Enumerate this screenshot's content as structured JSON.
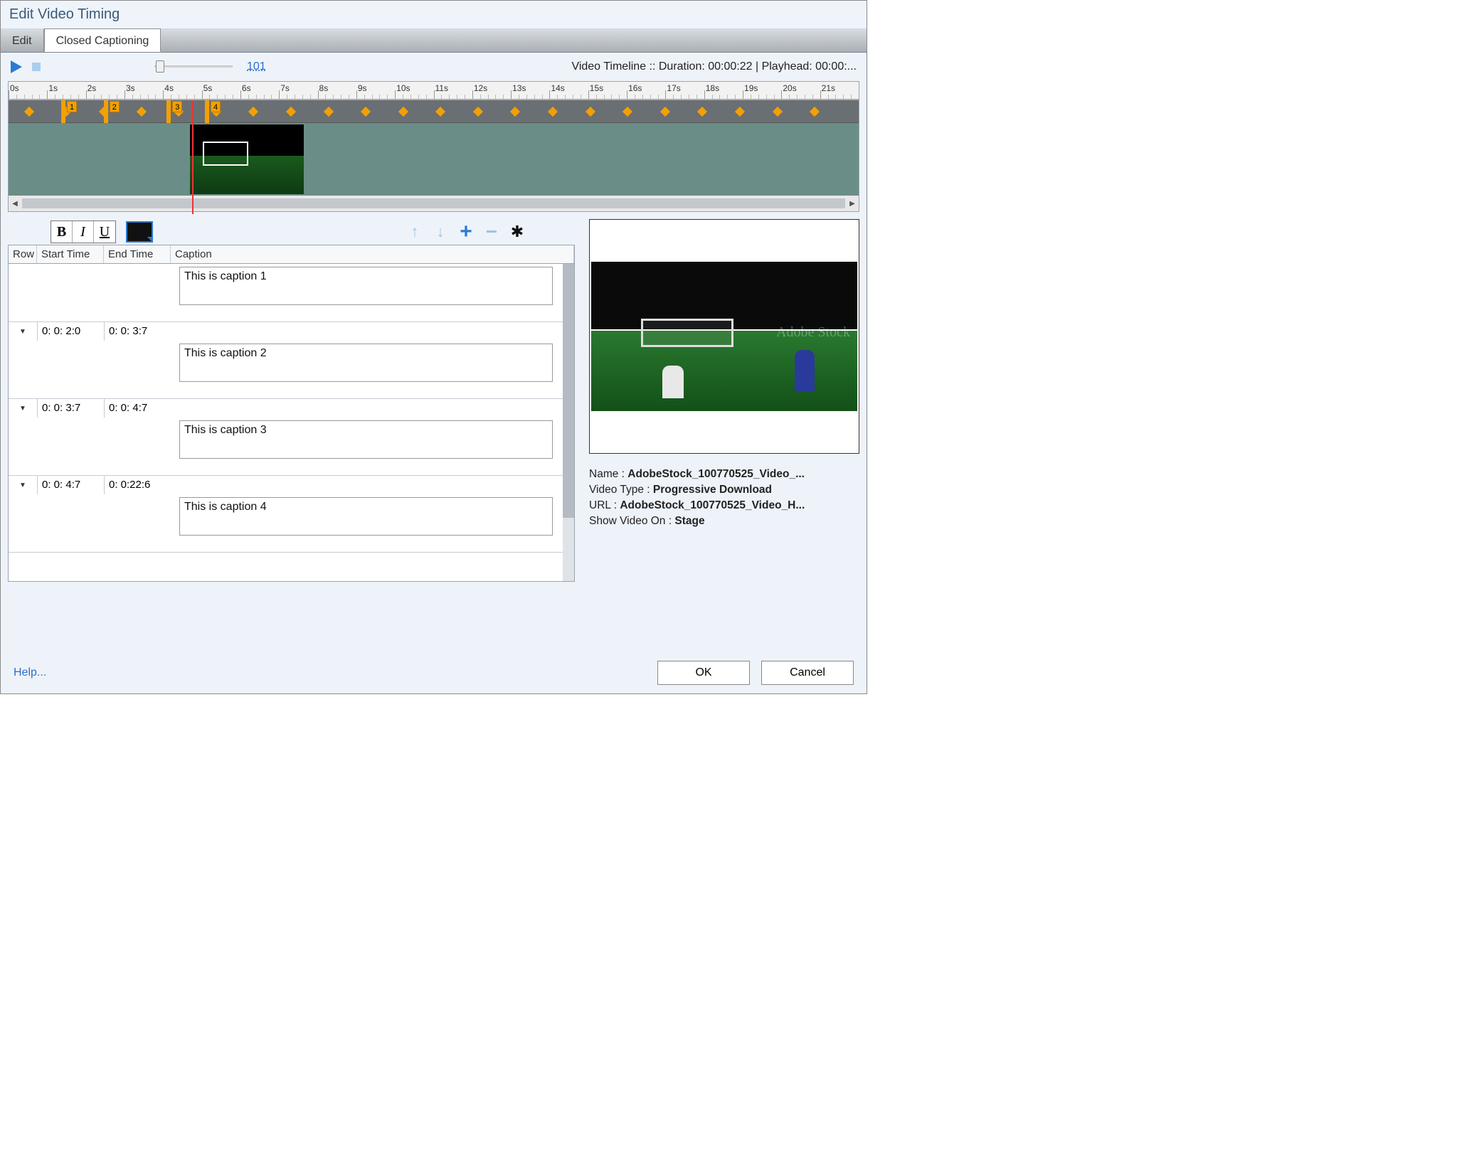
{
  "window": {
    "title": "Edit Video Timing"
  },
  "tabs": {
    "edit": "Edit",
    "cc": "Closed Captioning",
    "active": "cc"
  },
  "controls": {
    "zoom": "101"
  },
  "timeline": {
    "info": "Video Timeline :: Duration: 00:00:22  |  Playhead: 00:00:...",
    "seconds": 22,
    "markers": [
      {
        "label": "1",
        "posPct": 6.2
      },
      {
        "label": "2",
        "posPct": 11.2
      },
      {
        "label": "3",
        "posPct": 18.6
      },
      {
        "label": "4",
        "posPct": 23.1
      }
    ],
    "diamondStepPct": 4.4
  },
  "columns": {
    "row": "Row",
    "start": "Start Time",
    "end": "End Time",
    "cap": "Caption"
  },
  "rows": [
    {
      "start": "",
      "end": "",
      "caption": "This is caption 1"
    },
    {
      "start": "0: 0: 2:0",
      "end": "0: 0: 3:7",
      "caption": "This is caption 2"
    },
    {
      "start": "0: 0: 3:7",
      "end": "0: 0: 4:7",
      "caption": "This is caption 3"
    },
    {
      "start": "0: 0: 4:7",
      "end": "0: 0:22:6",
      "caption": "This is caption 4"
    }
  ],
  "preview": {
    "name_lbl": "Name  :",
    "name_val": "AdobeStock_100770525_Video_...",
    "type_lbl": "Video Type :",
    "type_val": "Progressive Download",
    "url_lbl": "URL :",
    "url_val": "AdobeStock_100770525_Video_H...",
    "show_lbl": "Show Video On :",
    "show_val": "Stage",
    "watermark": "Adobe Stock"
  },
  "footer": {
    "help": "Help...",
    "ok": "OK",
    "cancel": "Cancel"
  }
}
